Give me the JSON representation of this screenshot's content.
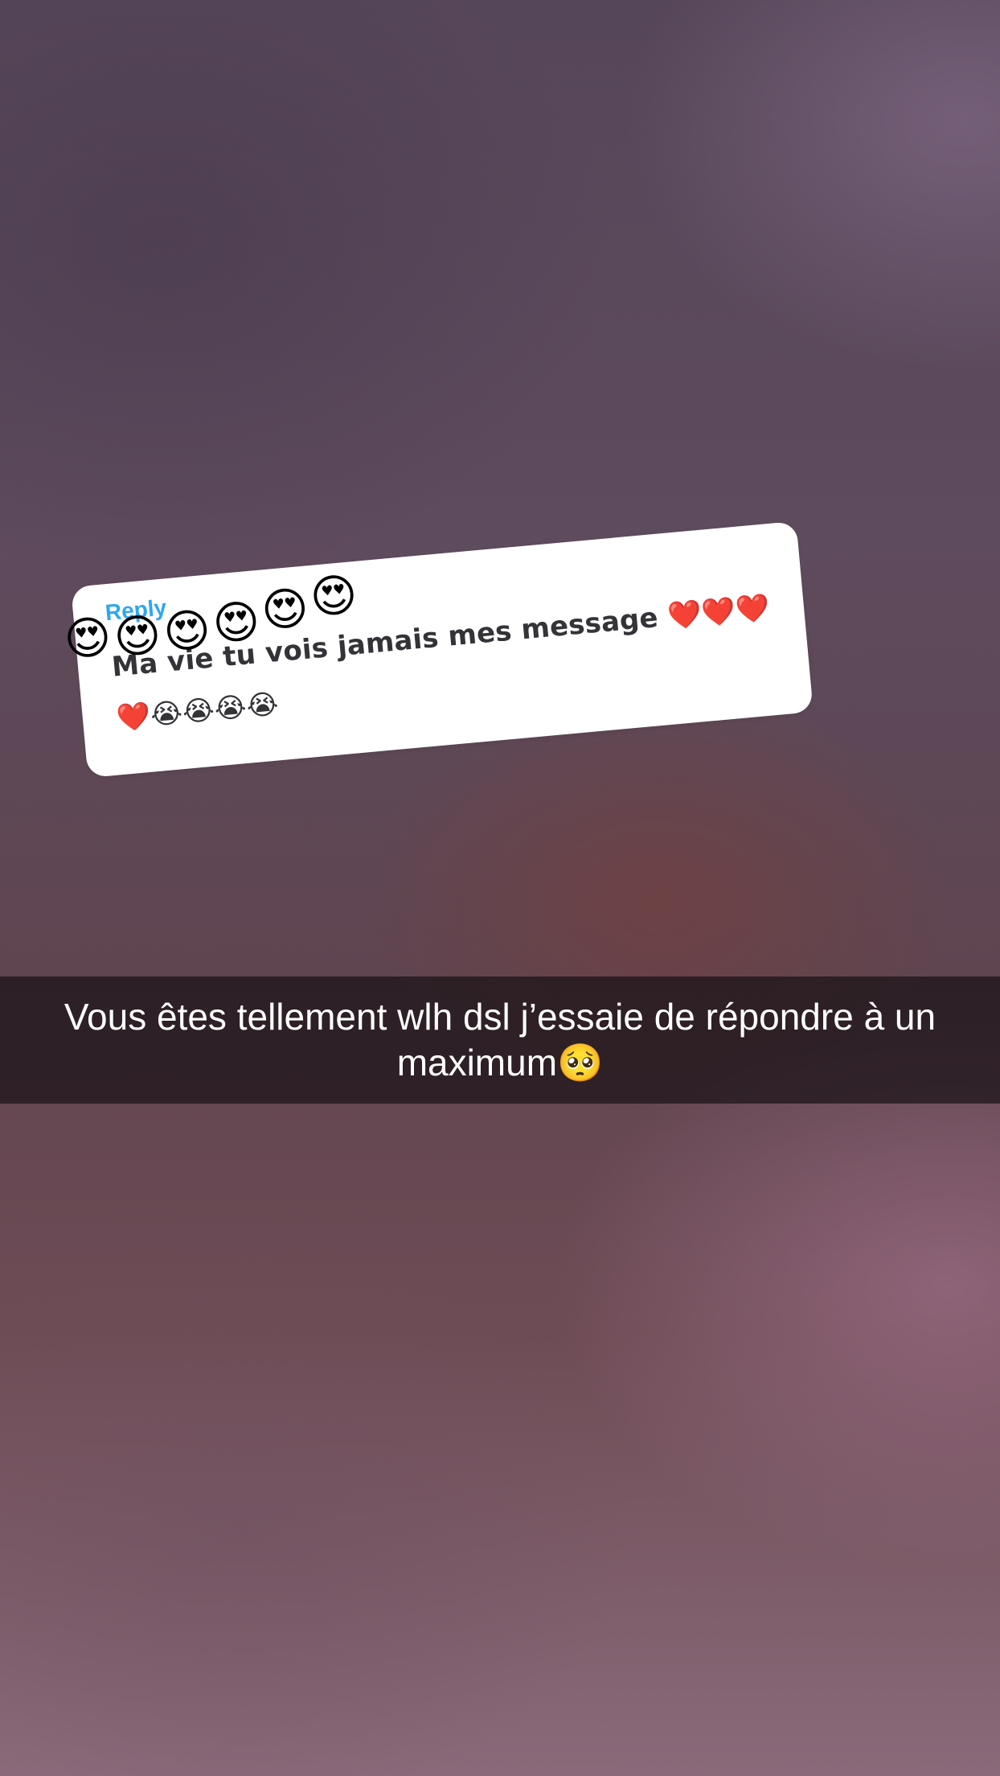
{
  "story": {
    "sticker": {
      "label": "Reply",
      "message": "Ma vie tu vois jamais mes message ❤️❤️❤️❤️😭😭😭😭",
      "emojis": [
        "😍",
        "😍",
        "😍",
        "😍",
        "😍",
        "😍"
      ]
    },
    "caption": "Vous êtes tellement wlh dsl j’essaie de répondre à un maximum🥺"
  }
}
